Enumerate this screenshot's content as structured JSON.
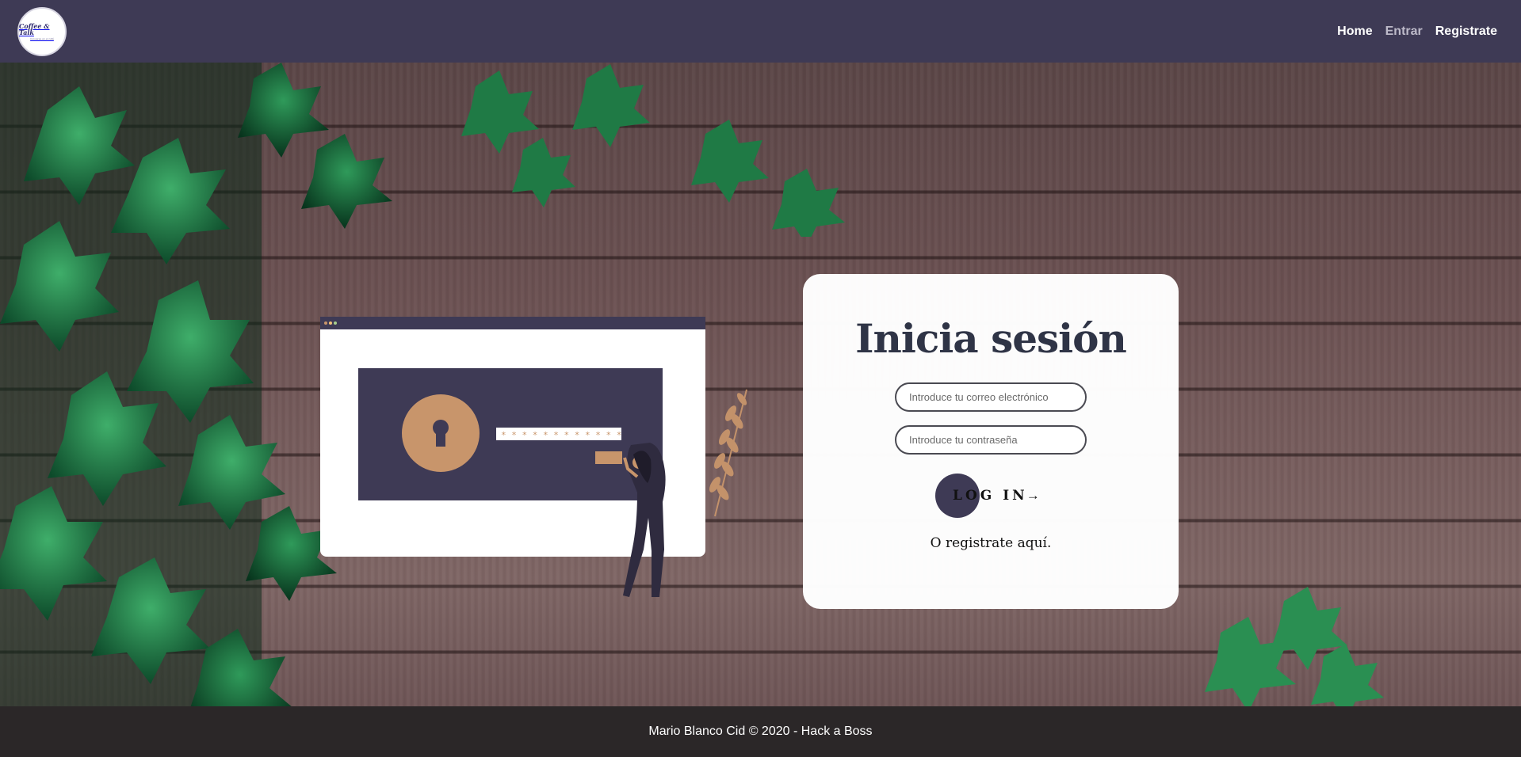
{
  "header": {
    "logo_text": "Coffee & Talk",
    "logo_subtext": "Conversa en el café",
    "nav": [
      {
        "label": "Home"
      },
      {
        "label": "Entrar"
      },
      {
        "label": "Registrate"
      }
    ]
  },
  "login": {
    "title": "Inicia sesión",
    "email_placeholder": "Introduce tu correo electrónico",
    "password_placeholder": "Introduce tu contraseña",
    "submit_label": "LOG IN",
    "submit_arrow": "→",
    "register_text": "O registrate aquí."
  },
  "illustration": {
    "password_mask": "* * * * * * * * * * * *"
  },
  "colors": {
    "primary": "#3e3a55",
    "accent": "#c8956b",
    "footer_bg": "#2b2728"
  },
  "footer": {
    "text": "Mario Blanco Cid © 2020 - Hack a Boss"
  }
}
